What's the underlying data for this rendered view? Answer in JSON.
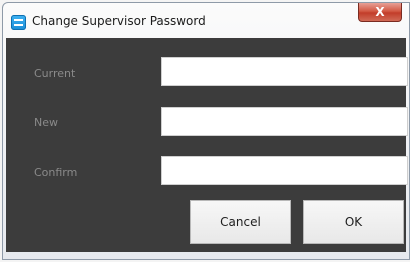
{
  "window": {
    "title": "Change Supervisor Password",
    "close_label": "X"
  },
  "form": {
    "current_label": "Current",
    "current_value": "",
    "new_label": "New",
    "new_value": "",
    "confirm_label": "Confirm",
    "confirm_value": ""
  },
  "buttons": {
    "cancel_label": "Cancel",
    "ok_label": "OK"
  },
  "colors": {
    "client_background": "#3c3c3c",
    "close_button": "#c94a36",
    "app_icon": "#2ba1e6"
  }
}
